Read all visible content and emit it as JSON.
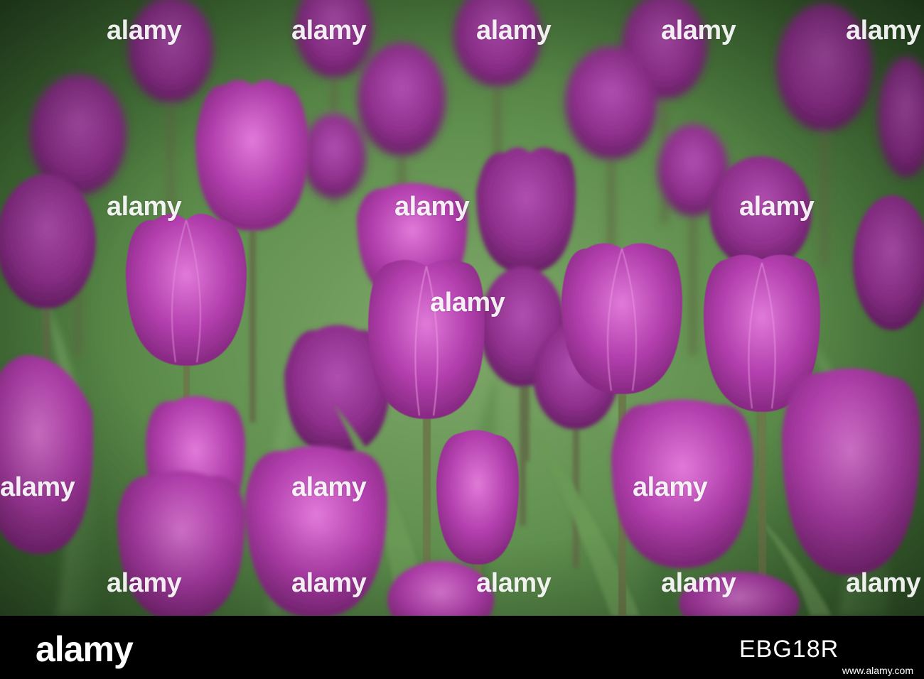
{
  "image": {
    "subject": "purple-tulip-field",
    "palette": {
      "petal_light": "#c860c8",
      "petal_mid": "#a8389f",
      "petal_dark": "#7d2478",
      "leaf": "#5f8f4e",
      "stem": "#6b7a4a"
    }
  },
  "watermark": {
    "text": "alamy"
  },
  "footer": {
    "logo": "alamy",
    "image_id": "EBG18R",
    "url": "www.alamy.com"
  }
}
